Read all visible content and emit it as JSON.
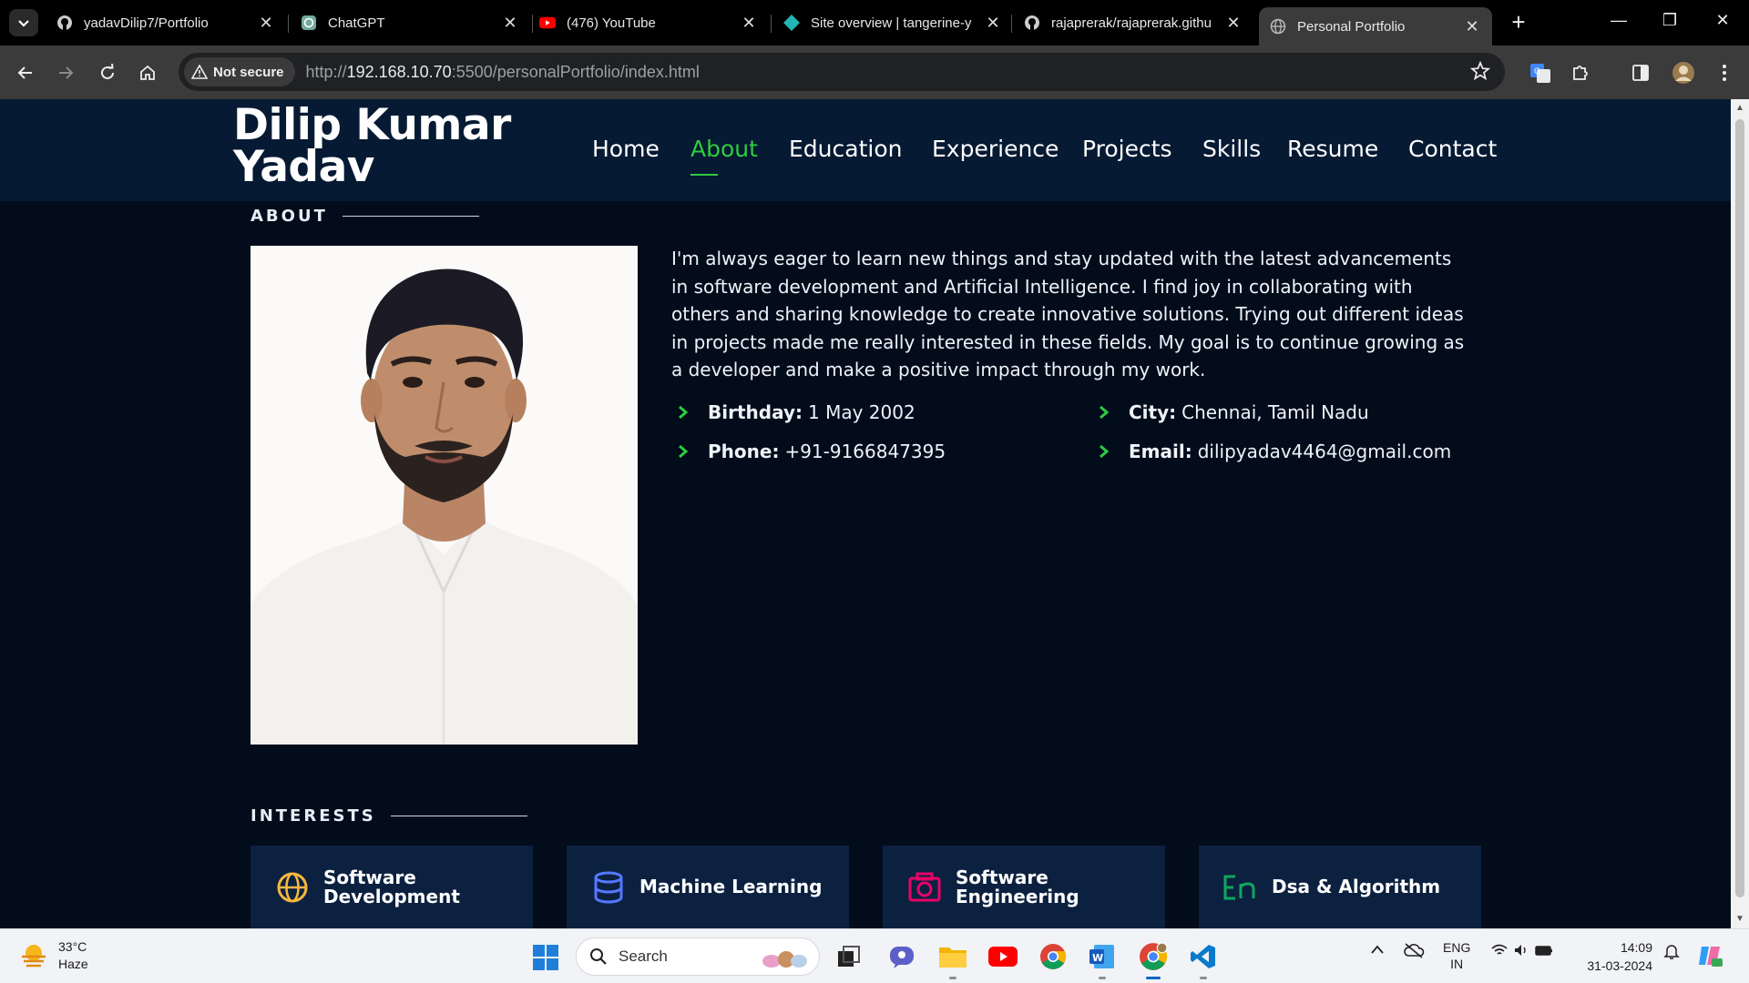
{
  "browser": {
    "tabs": [
      {
        "title": "yadavDilip7/Portfolio",
        "icon": "github-icon"
      },
      {
        "title": "ChatGPT",
        "icon": "chatgpt-icon"
      },
      {
        "title": "(476) YouTube",
        "icon": "youtube-icon"
      },
      {
        "title": "Site overview | tangerine-y",
        "icon": "netlify-icon"
      },
      {
        "title": "rajaprerak/rajaprerak.githu",
        "icon": "github-icon"
      },
      {
        "title": "Personal Portfolio",
        "icon": "globe-icon",
        "active": true
      }
    ],
    "security_label": "Not secure",
    "url_prefix": "http://",
    "url_host": "192.168.10.70",
    "url_path": ":5500/personalPortfolio/index.html"
  },
  "site": {
    "logo": "Dilip Kumar Yadav",
    "nav": [
      "Home",
      "About",
      "Education",
      "Experience",
      "Projects",
      "Skills",
      "Resume",
      "Contact"
    ],
    "active_nav": "About",
    "accent_color": "#2ecc40"
  },
  "about": {
    "heading": "ABOUT",
    "text": "I'm always eager to learn new things and stay updated with the latest advancements in software development and Artificial Intelligence. I find joy in collaborating with others and sharing knowledge to create innovative solutions. Trying out different ideas in projects made me really interested in these fields. My goal is to continue growing as a developer and make a positive impact through my work.",
    "details": [
      {
        "label": "Birthday:",
        "value": "1 May 2002"
      },
      {
        "label": "City:",
        "value": "Chennai, Tamil Nadu"
      },
      {
        "label": "Phone:",
        "value": "+91-9166847395"
      },
      {
        "label": "Email:",
        "value": "dilipyadav4464@gmail.com"
      }
    ]
  },
  "interests": {
    "heading": "INTERESTS",
    "items": [
      {
        "label": "Software Development",
        "icon": "globe-icon",
        "color": "#f5b83d"
      },
      {
        "label": "Machine Learning",
        "icon": "database-icon",
        "color": "#5578ff"
      },
      {
        "label": "Software Engineering",
        "icon": "camera-icon",
        "color": "#e80368"
      },
      {
        "label": "Dsa & Algorithm",
        "icon": "language-icon",
        "color": "#11a75f"
      }
    ]
  },
  "taskbar": {
    "temperature": "33°C",
    "weather": "Haze",
    "search_label": "Search",
    "lang": "ENG",
    "region": "IN",
    "time": "14:09",
    "date": "31-03-2024"
  }
}
